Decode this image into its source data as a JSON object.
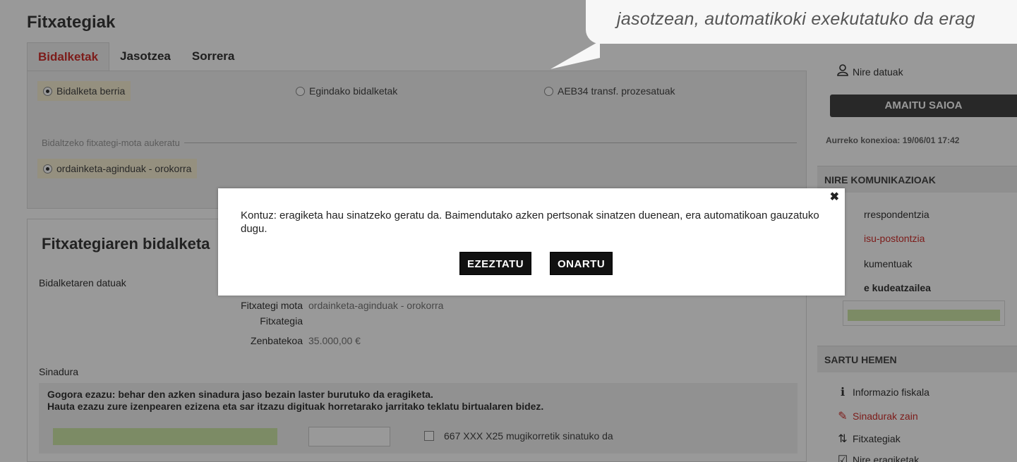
{
  "page": {
    "title": "Fitxategiak",
    "tabs": [
      "Bidalketak",
      "Jasotzea",
      "Sorrera"
    ]
  },
  "send_options": {
    "new_send": "Bidalketa berria",
    "done_sends": "Egindako bidalketak",
    "aeb34": "AEB34 transf. prozesatuak",
    "file_type_legend": "Bidaltzeko fitxategi-mota aukeratu",
    "file_type_value": "ordainketa-aginduak - orokorra"
  },
  "form": {
    "title": "Fitxategiaren bidalketa",
    "details_heading": "Bidalketaren datuak",
    "file_type_label": "Fitxategi mota",
    "file_type_value": "ordainketa-aginduak - orokorra",
    "file_label": "Fitxategia",
    "amount_label": "Zenbatekoa",
    "amount_value": "35.000,00 €",
    "signature_heading": "Sinadura",
    "sign_line1": "Gogora ezazu: behar den azken sinadura jaso bezain laster burutuko da eragiketa.",
    "sign_line2": "Hauta ezazu zure izenpearen ezizena eta sar itzazu digituak horretarako jarritako teklatu birtualaren bidez.",
    "mobile_sign": "667 XXX X25 mugikorretik sinatuko da"
  },
  "sidebar": {
    "my_data": "Nire datuak",
    "logout": "AMAITU SAIOA",
    "last_connection": "Aurreko konexioa: 19/06/01 17:42",
    "comms_heading": "NIRE KOMUNIKAZIOAK",
    "comms_items": [
      "rrespondentzia",
      "isu-postontzia",
      "kumentuak",
      "e kudeatzailea"
    ],
    "enter_heading": "SARTU HEMEN",
    "enter_items": [
      "Informazio fiskala",
      "Sinadurak zain",
      "Fitxategiak",
      "Nire eragiketak"
    ]
  },
  "bubble": {
    "text": "jasotzean, automatikoki exekutatuko da erag"
  },
  "modal": {
    "message": "Kontuz: eragiketa hau sinatzeko geratu da. Baimendutako azken pertsonak sinatzen duenean, era automatikoan gauzatuko dugu.",
    "close": "✖",
    "cancel": "EZEZTATU",
    "ok": "ONARTU"
  },
  "colors": {
    "accent_red": "#d0312d",
    "highlight": "#f8f1d4",
    "green_field": "#cfe8a9"
  }
}
